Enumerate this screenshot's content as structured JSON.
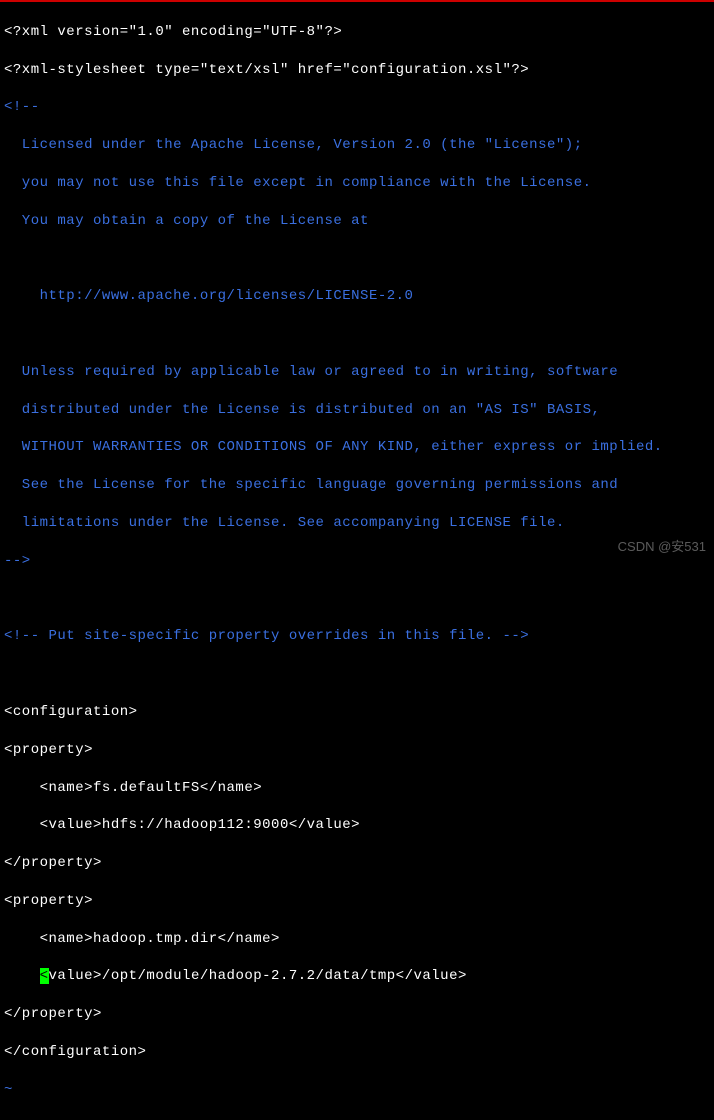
{
  "file": {
    "xml_decl": "<?xml version=\"1.0\" encoding=\"UTF-8\"?>",
    "stylesheet": "<?xml-stylesheet type=\"text/xsl\" href=\"configuration.xsl\"?>",
    "comment_open": "<!--",
    "comment_l1": "  Licensed under the Apache License, Version 2.0 (the \"License\");",
    "comment_l2": "  you may not use this file except in compliance with the License.",
    "comment_l3": "  You may obtain a copy of the License at",
    "comment_blank1": "",
    "comment_l4": "    http://www.apache.org/licenses/LICENSE-2.0",
    "comment_blank2": "",
    "comment_l5": "  Unless required by applicable law or agreed to in writing, software",
    "comment_l6": "  distributed under the License is distributed on an \"AS IS\" BASIS,",
    "comment_l7": "  WITHOUT WARRANTIES OR CONDITIONS OF ANY KIND, either express or implied.",
    "comment_l8": "  See the License for the specific language governing permissions and",
    "comment_l9": "  limitations under the License. See accompanying LICENSE file.",
    "comment_close": "-->",
    "blank1": "",
    "site_comment": "<!-- Put site-specific property overrides in this file. -->",
    "blank2": "",
    "conf_open": "<configuration>",
    "p1_open": "<property>",
    "p1_name": "    <name>fs.defaultFS</name>",
    "p1_value": "    <value>hdfs://hadoop112:9000</value>",
    "p1_close": "</property>",
    "p2_open": "<property>",
    "p2_name": "    <name>hadoop.tmp.dir</name>",
    "p2_value_pre": "    ",
    "p2_value_cursor": "<",
    "p2_value_post": "value>/opt/module/hadoop-2.7.2/data/tmp</value>",
    "p2_close": "</property>",
    "conf_close": "</configuration>",
    "tilde": "~"
  },
  "watermark": "CSDN @安531"
}
